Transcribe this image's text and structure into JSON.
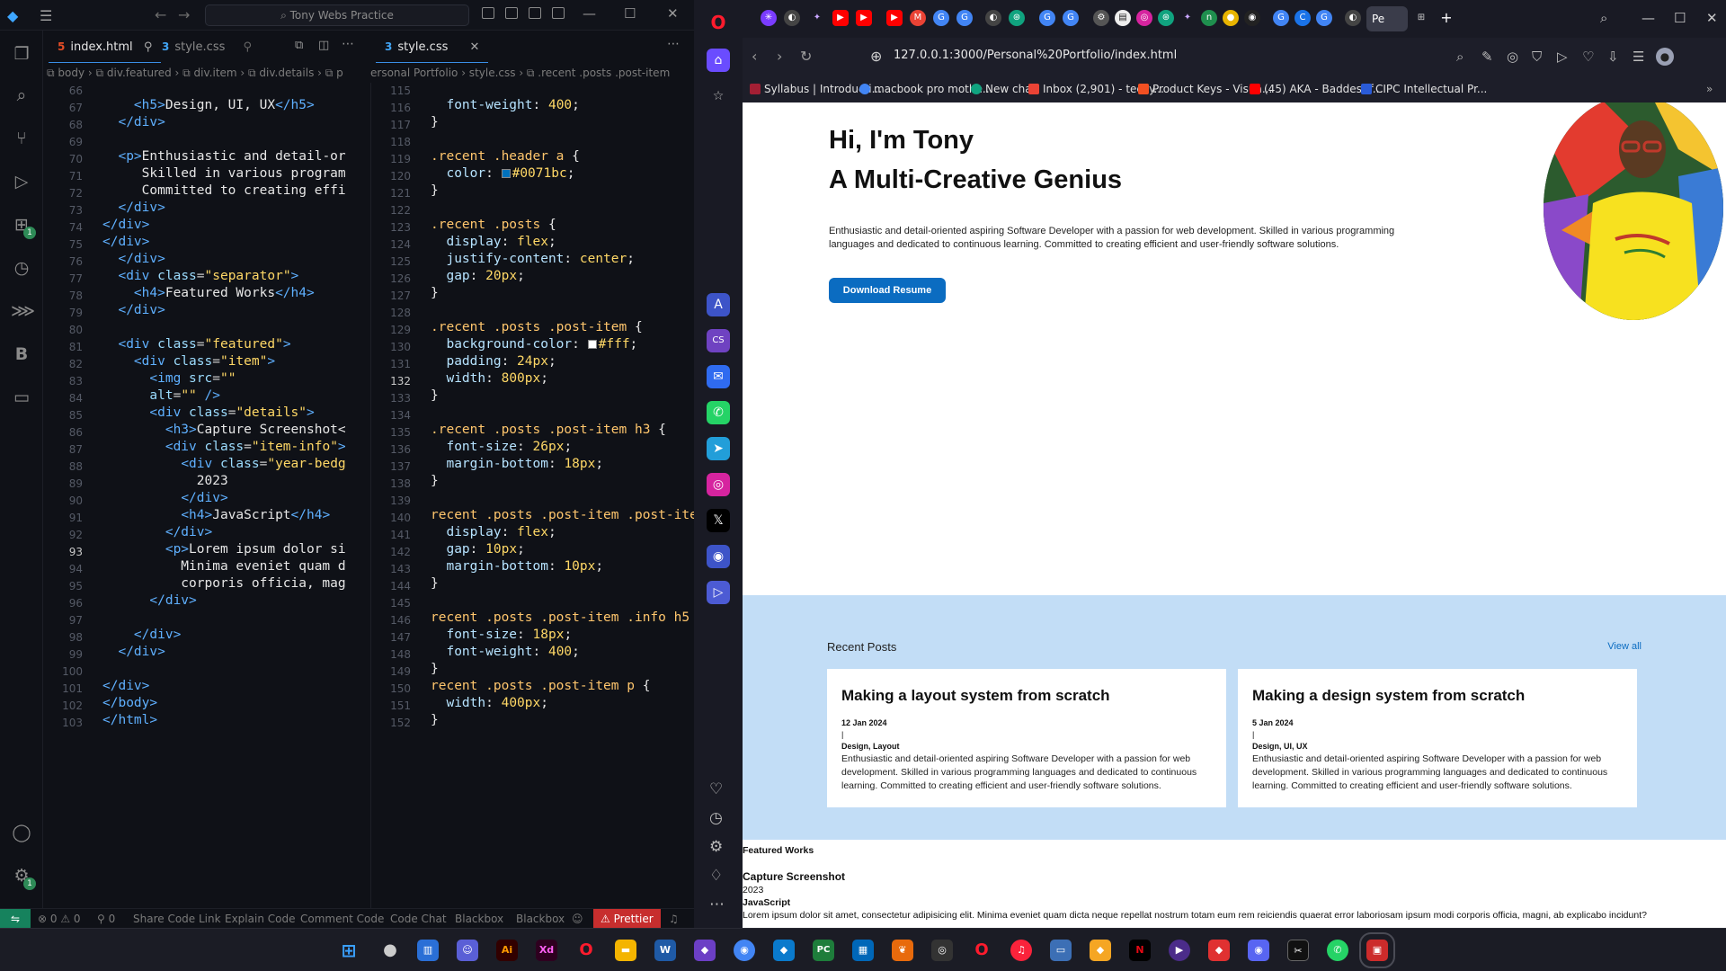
{
  "vscode": {
    "search_text": "⌕ Tony Webs Practice",
    "tabs": [
      {
        "label": "index.html",
        "pin": "⚲"
      },
      {
        "label": "style.css"
      },
      {
        "label": "style.css"
      }
    ],
    "breadcrumb_left": "⧉ body  ›  ⧉ div.featured  ›  ⧉ div.item  ›  ⧉ div.details  ›  ⧉ p",
    "breadcrumb_right": "ersonal Portfolio  ›  style.css  ›  ⧉ .recent .posts .post-item",
    "html_lines": [
      "66",
      "67",
      "68",
      "69",
      "70",
      "71",
      "72",
      "73",
      "74",
      "75",
      "76",
      "77",
      "78",
      "79",
      "80",
      "81",
      "82",
      "83",
      "84",
      "85",
      "86",
      "87",
      "88",
      "89",
      "90",
      "91",
      "92",
      "93",
      "94",
      "95",
      "96",
      "97",
      "98",
      "99",
      "100",
      "101",
      "102",
      "103"
    ],
    "css_lines": [
      "115",
      "116",
      "117",
      "118",
      "119",
      "120",
      "121",
      "122",
      "123",
      "124",
      "125",
      "126",
      "127",
      "128",
      "129",
      "130",
      "131",
      "132",
      "133",
      "134",
      "135",
      "136",
      "137",
      "138",
      "139",
      "140",
      "141",
      "142",
      "143",
      "144",
      "145",
      "146",
      "147",
      "148",
      "149",
      "150",
      "151",
      "152"
    ],
    "status": {
      "problems": "⊗ 0 ⚠ 0",
      "ports": "⚲ 0",
      "items": [
        "Share Code Link",
        "Explain Code",
        "Comment Code",
        "Code Chat",
        "Blackbox",
        "Blackbox"
      ],
      "prettier": "⚠ Prettier"
    }
  },
  "browser": {
    "url": "127.0.0.1:3000/Personal%20Portfolio/index.html",
    "active_tab": "Pe",
    "bookmarks": [
      {
        "label": "Syllabus | Introducti...",
        "color": "#a31f34"
      },
      {
        "label": "macbook pro mothe...",
        "color": "#4285f4"
      },
      {
        "label": "New chat",
        "color": "#10a37f"
      },
      {
        "label": "Inbox (2,901) - teezy...",
        "color": "#ea4335"
      },
      {
        "label": "Product Keys - Visua...",
        "color": "#f25022"
      },
      {
        "label": "(45) AKA - Baddest f...",
        "color": "#ff0000"
      },
      {
        "label": "CIPC Intellectual Pr...",
        "color": "#2a5bd7"
      }
    ]
  },
  "portfolio": {
    "hero_line1": "Hi, I'm Tony",
    "hero_line2": "A Multi-Creative Genius",
    "hero_desc": "Enthusiastic and detail-oriented aspiring Software Developer with a passion for web development. Skilled in various programming languages and dedicated to continuous learning. Committed to creating efficient and user-friendly software solutions.",
    "download_label": "Download Resume",
    "recent_heading": "Recent Posts",
    "view_all": "View all",
    "posts": [
      {
        "title": "Making a layout system from scratch",
        "date": "12 Jan 2024",
        "separator": "|",
        "tags": "Design, Layout",
        "body": "Enthusiastic and detail-oriented aspiring Software Developer with a passion for web development. Skilled in various programming languages and dedicated to continuous learning. Committed to creating efficient and user-friendly software solutions."
      },
      {
        "title": "Making a design system from scratch",
        "date": "5 Jan 2024",
        "separator": "|",
        "tags": "Design, UI, UX",
        "body": "Enthusiastic and detail-oriented aspiring Software Developer with a passion for web development. Skilled in various programming languages and dedicated to continuous learning. Committed to creating efficient and user-friendly software solutions."
      }
    ],
    "featured_heading": "Featured Works",
    "featured_title": "Capture Screenshot",
    "featured_year": "2023",
    "featured_lang": "JavaScript",
    "featured_body": "Lorem ipsum dolor sit amet, consectetur adipisicing elit. Minima eveniet quam dicta neque repellat nostrum totam eum rem reiciendis quaerat error laboriosam ipsum modi corporis officia, magni, ab explicabo incidunt?"
  },
  "colors": {
    "accent": "#0b6cc1",
    "recent_bg": "#c2ddf6",
    "css_color_value": "#0071bc"
  }
}
